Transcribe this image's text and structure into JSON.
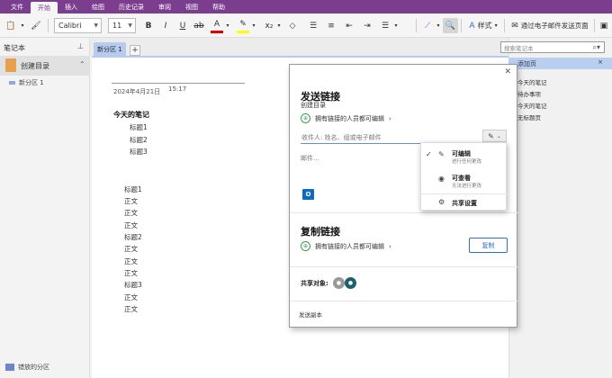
{
  "menubar": {
    "tabs": [
      "文件",
      "开始",
      "插入",
      "绘图",
      "历史记录",
      "审阅",
      "视图",
      "帮助"
    ]
  },
  "ribbon": {
    "font_name": "Calibri",
    "font_size": "11",
    "styles_label": "样式",
    "email_page_label": "通过电子邮件发送页面"
  },
  "left_pane": {
    "title": "笔记本",
    "notebook": "创建目录",
    "section": "新分区 1",
    "misplaced": "错放的分区"
  },
  "section_tabs": {
    "active": "新分区 1",
    "add": "+"
  },
  "page": {
    "date": "2024年4月21日",
    "time": "15:17",
    "heading": "今天的笔记",
    "indented": [
      "标题1",
      "标题2",
      "标题3"
    ],
    "body": [
      "标题1",
      "正文",
      "正文",
      "正文",
      "标题2",
      "正文",
      "正文",
      "正文",
      "标题3",
      "正文",
      "正文"
    ]
  },
  "right_pane": {
    "search_placeholder": "搜索笔记本",
    "add_page": "添加页",
    "pages": [
      "今天的笔记",
      "待办事项",
      "今天的笔记",
      "无标题页"
    ]
  },
  "share_dialog": {
    "title": "发送链接",
    "subtitle": "创建目录",
    "permission": "拥有链接的人员都可编辑",
    "recipients_placeholder": "收件人: 姓名、组或电子邮件",
    "message_placeholder": "邮件...",
    "copy_title": "复制链接",
    "copy_permission": "拥有链接的人员都可编辑",
    "copy_button": "复制",
    "shared_with": "共享对象:",
    "send_copy": "发送副本"
  },
  "perm_menu": {
    "edit_title": "可编辑",
    "edit_desc": "进行任何更改",
    "view_title": "可查看",
    "view_desc": "无法进行更改",
    "settings": "共享设置"
  },
  "colors": {
    "brand": "#7b3e8e",
    "section_tab": "#b7cbef",
    "link_blue": "#2f6fc6",
    "outlook": "#0f6cbd"
  },
  "icons": [
    "paste-icon",
    "format-painter-icon",
    "bold-icon",
    "italic-icon",
    "underline-icon",
    "strikethrough-icon",
    "font-color-icon",
    "highlight-icon",
    "subscript-icon",
    "eraser-icon",
    "clear-formatting-icon",
    "search-icon",
    "pin-icon",
    "close-icon",
    "globe-icon",
    "pencil-icon",
    "eye-icon",
    "gear-icon",
    "outlook-icon",
    "email-icon"
  ]
}
